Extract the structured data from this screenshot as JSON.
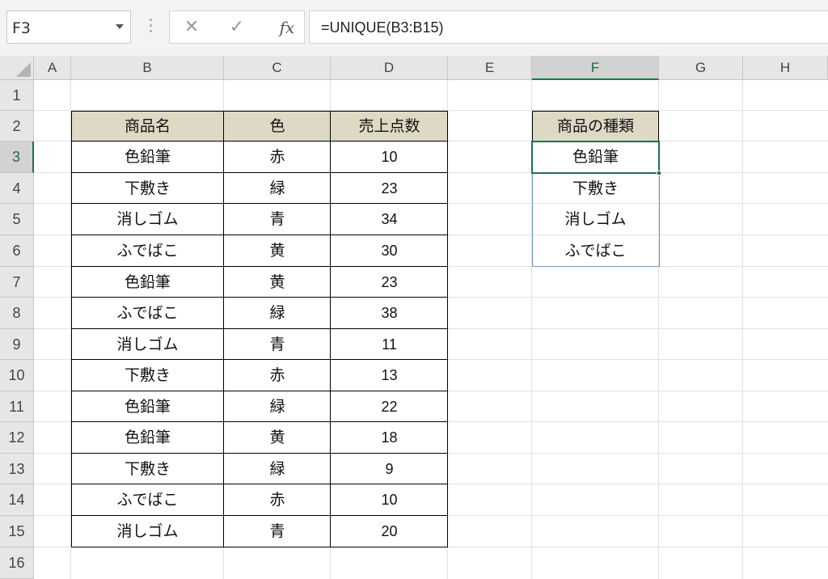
{
  "namebox": {
    "value": "F3"
  },
  "formula_bar": {
    "cancel_icon": "✕",
    "enter_icon": "✓",
    "fx_label": "fx",
    "formula": "=UNIQUE(B3:B15)"
  },
  "columns": [
    "A",
    "B",
    "C",
    "D",
    "E",
    "F",
    "G",
    "H"
  ],
  "rows": [
    "1",
    "2",
    "3",
    "4",
    "5",
    "6",
    "7",
    "8",
    "9",
    "10",
    "11",
    "12",
    "13",
    "14",
    "15",
    "16"
  ],
  "selected_cell": "F3",
  "table": {
    "headers": [
      "商品名",
      "色",
      "売上点数"
    ],
    "rows": [
      [
        "色鉛筆",
        "赤",
        "10"
      ],
      [
        "下敷き",
        "緑",
        "23"
      ],
      [
        "消しゴム",
        "青",
        "34"
      ],
      [
        "ふでばこ",
        "黄",
        "30"
      ],
      [
        "色鉛筆",
        "黄",
        "23"
      ],
      [
        "ふでばこ",
        "緑",
        "38"
      ],
      [
        "消しゴム",
        "青",
        "11"
      ],
      [
        "下敷き",
        "赤",
        "13"
      ],
      [
        "色鉛筆",
        "緑",
        "22"
      ],
      [
        "色鉛筆",
        "黄",
        "18"
      ],
      [
        "下敷き",
        "緑",
        "9"
      ],
      [
        "ふでばこ",
        "赤",
        "10"
      ],
      [
        "消しゴム",
        "青",
        "20"
      ]
    ]
  },
  "unique_list": {
    "header": "商品の種類",
    "items": [
      "色鉛筆",
      "下敷き",
      "消しゴム",
      "ふでばこ"
    ]
  },
  "colors": {
    "header_fill": "#ded9c4",
    "selection": "#217346",
    "spill_border": "#6c9bd0"
  }
}
